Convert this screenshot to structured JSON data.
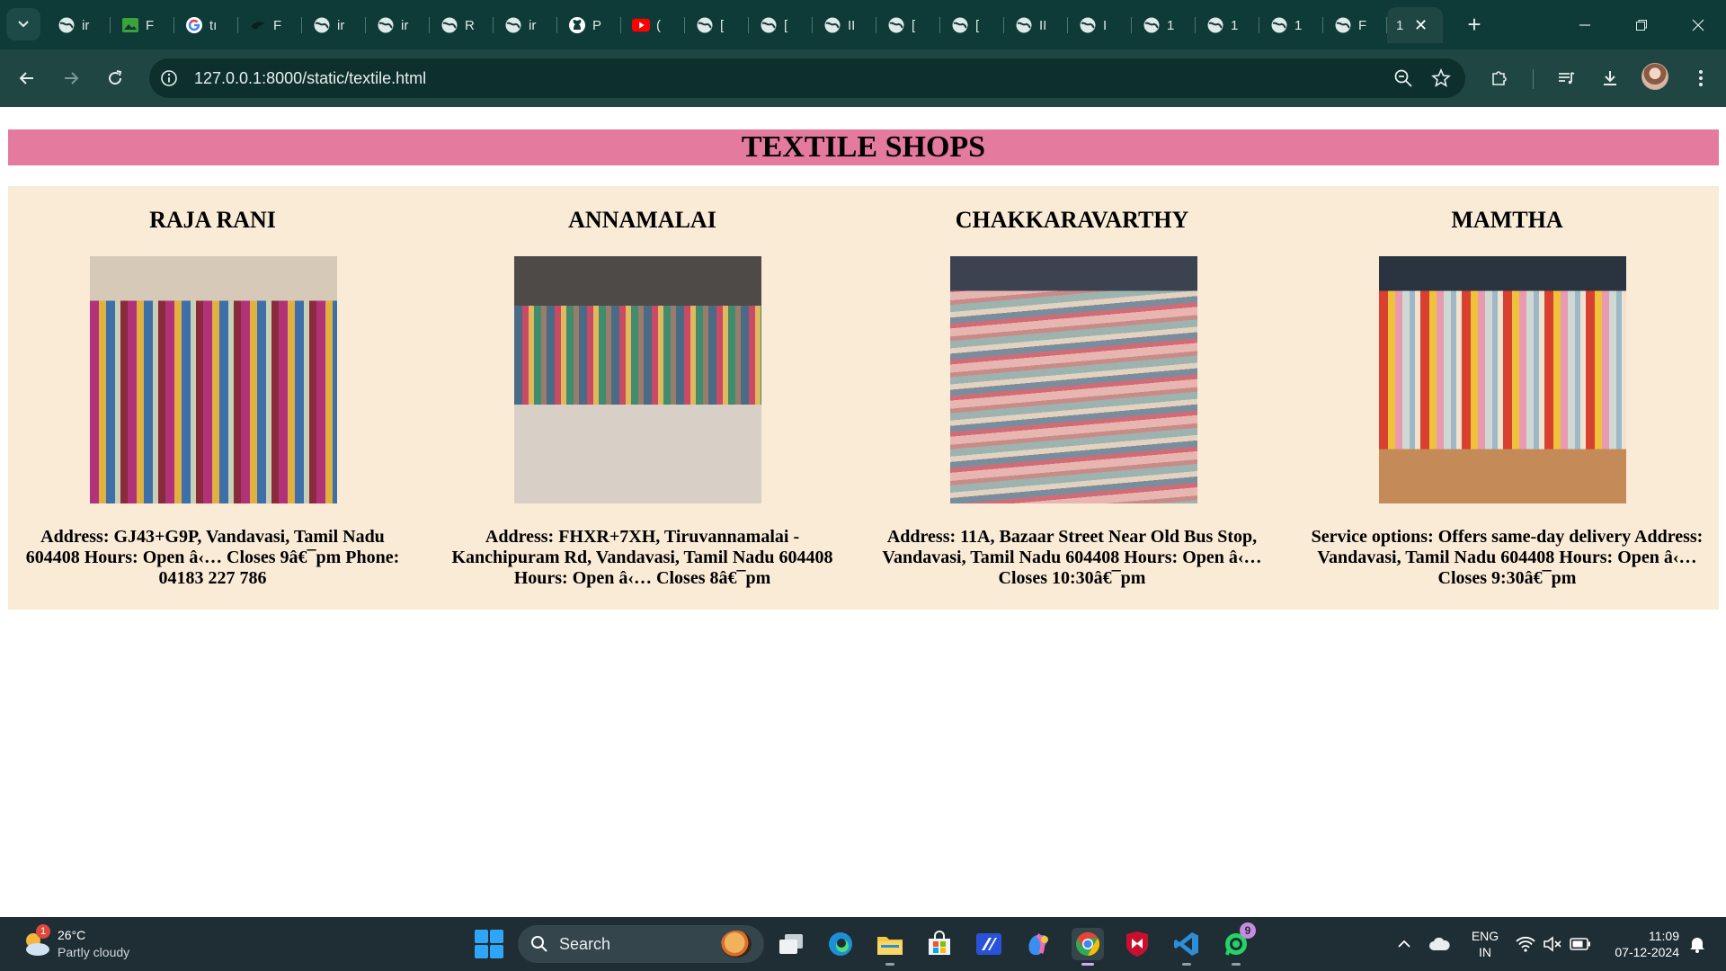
{
  "browser": {
    "tabs": [
      {
        "title": "ir",
        "icon": "globe-icon"
      },
      {
        "title": "F",
        "icon": "image-icon"
      },
      {
        "title": "tı",
        "icon": "google-icon"
      },
      {
        "title": "F",
        "icon": "bird-icon"
      },
      {
        "title": "ir",
        "icon": "globe-icon"
      },
      {
        "title": "ir",
        "icon": "globe-icon"
      },
      {
        "title": "R",
        "icon": "globe-icon"
      },
      {
        "title": "ir",
        "icon": "globe-icon"
      },
      {
        "title": "P",
        "icon": "github-icon"
      },
      {
        "title": "(",
        "icon": "youtube-icon"
      },
      {
        "title": "[",
        "icon": "globe-icon"
      },
      {
        "title": "[",
        "icon": "globe-icon"
      },
      {
        "title": "II",
        "icon": "globe-icon"
      },
      {
        "title": "[",
        "icon": "globe-icon"
      },
      {
        "title": "[",
        "icon": "globe-icon"
      },
      {
        "title": "II",
        "icon": "globe-icon"
      },
      {
        "title": "I",
        "icon": "globe-icon"
      },
      {
        "title": "1",
        "icon": "globe-icon"
      },
      {
        "title": "1",
        "icon": "globe-icon"
      },
      {
        "title": "1",
        "icon": "globe-icon"
      },
      {
        "title": "F",
        "icon": "globe-icon"
      }
    ],
    "active_tab": {
      "title": "1",
      "close": "✕"
    },
    "new_tab": "+",
    "url": "127.0.0.1:8000/static/textile.html"
  },
  "page": {
    "title": "TEXTILE SHOPS",
    "background": "#faebd7",
    "banner_color": "#e57a9f",
    "shops": [
      {
        "name": "RAJA RANI",
        "details": "Address: GJ43+G9P, Vandavasi, Tamil Nadu 604408 Hours: Open â‹… Closes 9â€¯pm Phone: 04183 227 786"
      },
      {
        "name": "ANNAMALAI",
        "details": "Address: FHXR+7XH, Tiruvannamalai - Kanchipuram Rd, Vandavasi, Tamil Nadu 604408 Hours: Open â‹… Closes 8â€¯pm"
      },
      {
        "name": "CHAKKARAVARTHY",
        "details": "Address: 11A, Bazaar Street Near Old Bus Stop, Vandavasi, Tamil Nadu 604408 Hours: Open â‹… Closes 10:30â€¯pm"
      },
      {
        "name": "MAMTHA",
        "details": "Service options: Offers same-day delivery Address: Vandavasi, Tamil Nadu 604408 Hours: Open â‹… Closes 9:30â€¯pm"
      }
    ]
  },
  "taskbar": {
    "weather": {
      "temp": "26°C",
      "desc": "Partly cloudy",
      "badge": "1"
    },
    "search_label": "Search",
    "whatsapp_badge": "9",
    "lang_line1": "ENG",
    "lang_line2": "IN",
    "time": "11:09",
    "date": "07-12-2024"
  }
}
